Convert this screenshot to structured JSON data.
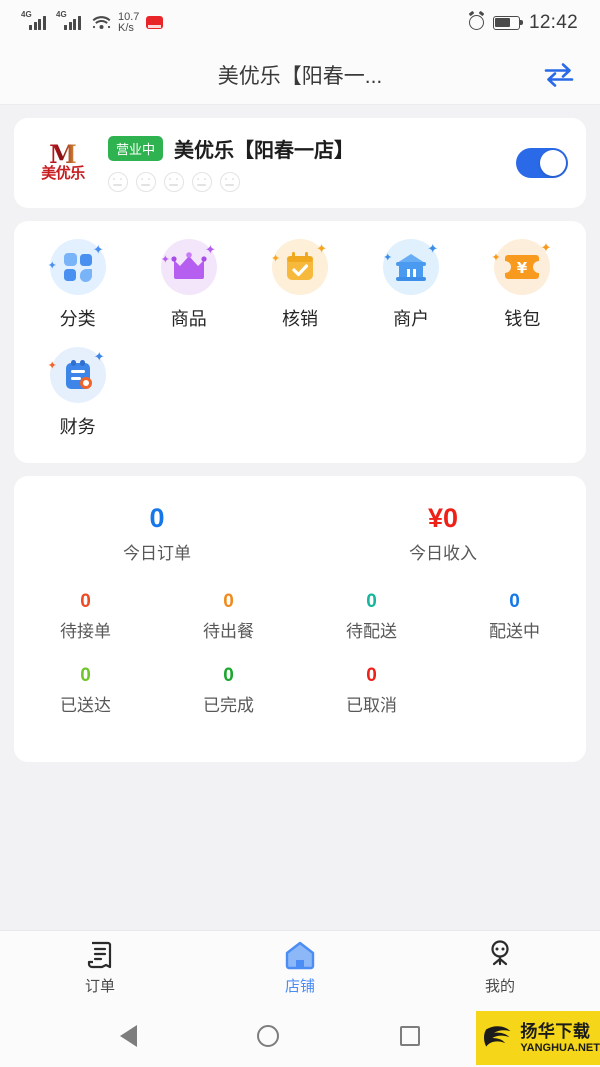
{
  "status_bar": {
    "network_1": "4G",
    "network_2": "4G",
    "speed_value": "10.7",
    "speed_unit": "K/s",
    "time": "12:42",
    "icons": [
      "signal-icon",
      "signal-icon",
      "wifi-icon",
      "app-notification-icon",
      "alarm-icon",
      "battery-icon"
    ]
  },
  "header": {
    "title": "美优乐【阳春一...",
    "switch_icon": "swap-store-icon",
    "accent": "#2a6ae8"
  },
  "store_card": {
    "logo_mark": "M",
    "logo_text": "美优乐",
    "status_badge": "营业中",
    "badge_color": "#2fb350",
    "name": "美优乐【阳春一店】",
    "rating_count": 5,
    "rating_filled": 0,
    "toggle_on": true,
    "toggle_color": "#2a6ae8"
  },
  "menu": {
    "items": [
      {
        "label": "分类",
        "icon": "category-grid-icon",
        "bg": "#e3f0ff",
        "color": "#4a90f0"
      },
      {
        "label": "商品",
        "icon": "crown-icon",
        "bg": "#f3e6fb",
        "color": "#a855e8"
      },
      {
        "label": "核销",
        "icon": "calendar-check-icon",
        "bg": "#fdefd8",
        "color": "#f5a623"
      },
      {
        "label": "商户",
        "icon": "bank-store-icon",
        "bg": "#e0f0fd",
        "color": "#3d8ee8"
      },
      {
        "label": "钱包",
        "icon": "wallet-ticket-icon",
        "bg": "#fdeedb",
        "color": "#f79a1e"
      },
      {
        "label": "财务",
        "icon": "finance-doc-icon",
        "bg": "#e6f0fd",
        "color": "#3d85e8"
      }
    ]
  },
  "stats": {
    "primary": [
      {
        "value": "0",
        "label": "今日订单",
        "color": "#1677e8"
      },
      {
        "value": "¥0",
        "label": "今日收入",
        "color": "#ee2119"
      }
    ],
    "secondary": [
      {
        "value": "0",
        "label": "待接单",
        "color": "#f04a22"
      },
      {
        "value": "0",
        "label": "待出餐",
        "color": "#f08a1e"
      },
      {
        "value": "0",
        "label": "待配送",
        "color": "#16b69a"
      },
      {
        "value": "0",
        "label": "配送中",
        "color": "#1677e8"
      },
      {
        "value": "0",
        "label": "已送达",
        "color": "#6ec62a"
      },
      {
        "value": "0",
        "label": "已完成",
        "color": "#1aa72e"
      },
      {
        "value": "0",
        "label": "已取消",
        "color": "#ee2119"
      }
    ]
  },
  "tabbar": {
    "items": [
      {
        "label": "订单",
        "icon": "receipt-icon",
        "active": false
      },
      {
        "label": "店铺",
        "icon": "store-house-icon",
        "active": true
      },
      {
        "label": "我的",
        "icon": "profile-person-icon",
        "active": false
      }
    ],
    "active_color": "#4b8cf5"
  },
  "android_nav": {
    "back": "back-triangle-icon",
    "home": "home-circle-icon",
    "recents": "recents-square-icon"
  },
  "watermark": {
    "cn": "扬华下载",
    "en": "YANGHUA.NET",
    "bg": "#f5d618"
  }
}
